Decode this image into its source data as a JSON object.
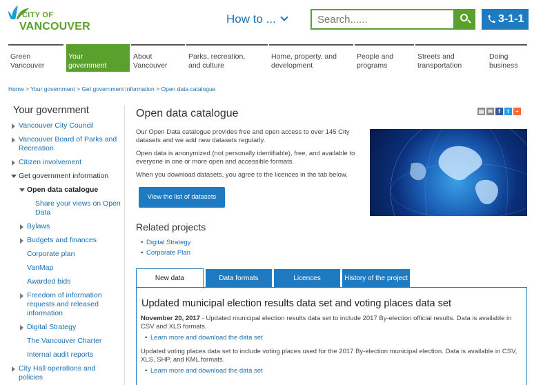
{
  "header": {
    "logo_city_of": "CITY OF",
    "logo_vancouver": "VANCOUVER",
    "howto_label": "How to ...",
    "search_placeholder": "Search......",
    "phone_label": "3-1-1"
  },
  "nav": {
    "items": [
      {
        "line1": "Green",
        "line2": "Vancouver"
      },
      {
        "line1": "Your",
        "line2": "government"
      },
      {
        "line1": "About",
        "line2": "Vancouver"
      },
      {
        "line1": "Parks, recreation,",
        "line2": "and culture"
      },
      {
        "line1": "Home, property, and",
        "line2": "development"
      },
      {
        "line1": "People and",
        "line2": "programs"
      },
      {
        "line1": "Streets and",
        "line2": "transportation"
      },
      {
        "line1": "Doing",
        "line2": "business"
      }
    ]
  },
  "breadcrumb": {
    "items": [
      "Home",
      "Your government",
      "Get government information",
      "Open data catalogue"
    ],
    "separator": ">"
  },
  "sidebar": {
    "title": "Your government",
    "items": [
      {
        "label": "Vancouver City Council"
      },
      {
        "label": "Vancouver Board of Parks and Recreation"
      },
      {
        "label": "Citizen involvement"
      },
      {
        "label": "Get government information"
      },
      {
        "label": "Open data catalogue"
      },
      {
        "label": "Share your views on Open Data"
      },
      {
        "label": "Bylaws"
      },
      {
        "label": "Budgets and finances"
      },
      {
        "label": "Corporate plan"
      },
      {
        "label": "VanMap"
      },
      {
        "label": "Awarded bids"
      },
      {
        "label": "Freedom of information requests and released information"
      },
      {
        "label": "Digital Strategy"
      },
      {
        "label": "The Vancouver Charter"
      },
      {
        "label": "Internal audit reports"
      },
      {
        "label": "City Hall operations and policies"
      }
    ]
  },
  "main": {
    "title": "Open data catalogue",
    "intro": [
      "Our Open Data catalogue provides free and open access to over 145 City datasets and we add new datasets regularly.",
      "Open data is anonymized (not personally identifiable), free, and available to everyone in one or more open and accessible formats.",
      "When you download datasets, you agree to the licences in the tab below."
    ],
    "view_button": "View the list of datasets",
    "related_title": "Related projects",
    "related": [
      "Digital Strategy",
      "Corporate Plan"
    ],
    "tabs": [
      "New data",
      "Data formats",
      "Licences",
      "History of the project"
    ],
    "news_title": "Updated municipal election results data set and voting places data set",
    "news_date": "November 20, 2017",
    "news_p1": " - Updated municipal election results data set to include 2017 By-election official results. Data is available in CSV and XLS formats.",
    "news_link1": "Learn more and download the data set",
    "news_p2": "Updated voting places data set to include voting places used for the 2017 By-election municipal election. Data is available in CSV, XLS, SHP, and KML formats.",
    "news_link2": "Learn more and download the data set"
  },
  "colors": {
    "brand_green": "#5aa02c",
    "brand_blue": "#1f7bc1",
    "link_blue": "#1a6fb2"
  }
}
